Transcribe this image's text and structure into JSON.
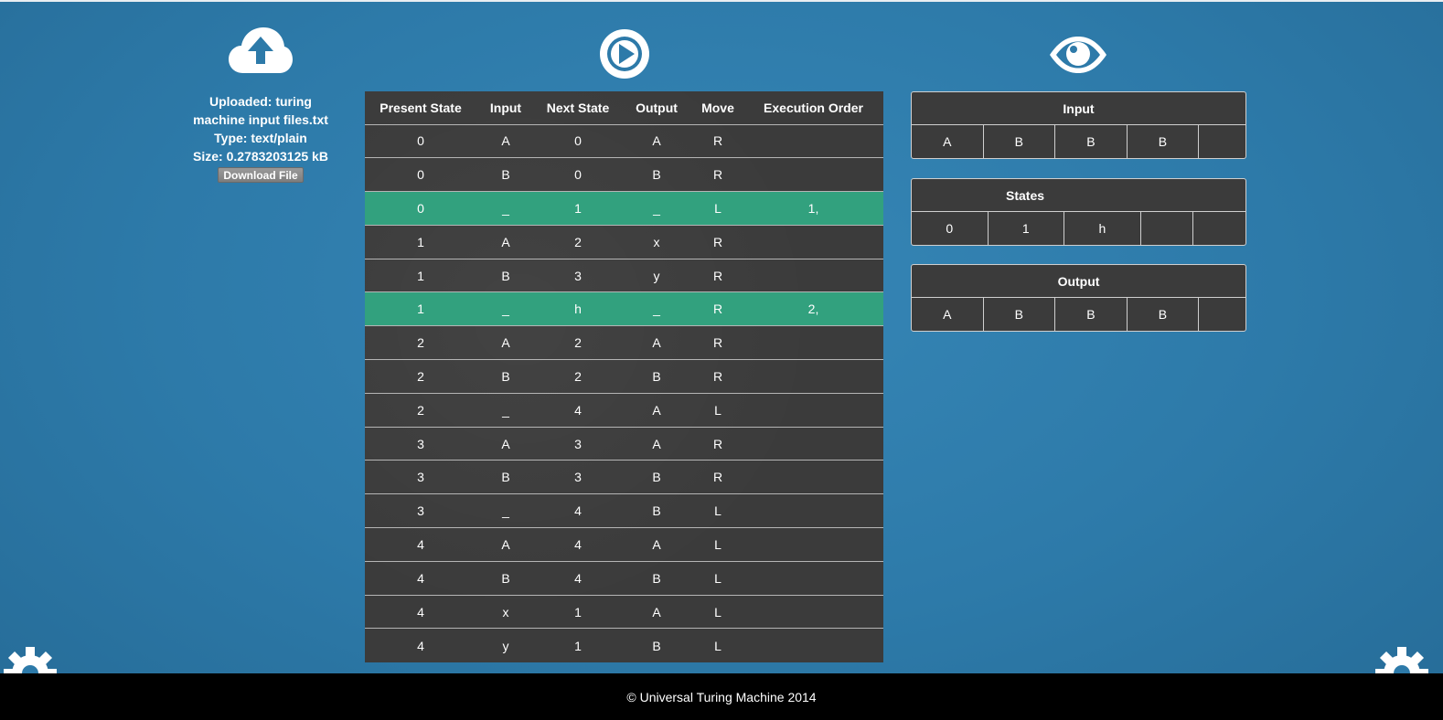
{
  "upload": {
    "icon": "cloud-upload-icon",
    "line1": "Uploaded: turing",
    "line2": "machine input files.txt",
    "type": "Type: text/plain",
    "size": "Size: 0.2783203125 kB",
    "download_label": "Download File"
  },
  "icons": {
    "play": "play-icon",
    "eye": "eye-icon",
    "gear": "gear-icon"
  },
  "rules": {
    "headers": [
      "Present State",
      "Input",
      "Next State",
      "Output",
      "Move",
      "Execution Order"
    ],
    "rows": [
      [
        "0",
        "A",
        "0",
        "A",
        "R",
        ""
      ],
      [
        "0",
        "B",
        "0",
        "B",
        "R",
        ""
      ],
      [
        "0",
        "_",
        "1",
        "_",
        "L",
        "1,"
      ],
      [
        "1",
        "A",
        "2",
        "x",
        "R",
        ""
      ],
      [
        "1",
        "B",
        "3",
        "y",
        "R",
        ""
      ],
      [
        "1",
        "_",
        "h",
        "_",
        "R",
        "2,"
      ],
      [
        "2",
        "A",
        "2",
        "A",
        "R",
        ""
      ],
      [
        "2",
        "B",
        "2",
        "B",
        "R",
        ""
      ],
      [
        "2",
        "_",
        "4",
        "A",
        "L",
        ""
      ],
      [
        "3",
        "A",
        "3",
        "A",
        "R",
        ""
      ],
      [
        "3",
        "B",
        "3",
        "B",
        "R",
        ""
      ],
      [
        "3",
        "_",
        "4",
        "B",
        "L",
        ""
      ],
      [
        "4",
        "A",
        "4",
        "A",
        "L",
        ""
      ],
      [
        "4",
        "B",
        "4",
        "B",
        "L",
        ""
      ],
      [
        "4",
        "x",
        "1",
        "A",
        "L",
        ""
      ],
      [
        "4",
        "y",
        "1",
        "B",
        "L",
        ""
      ]
    ]
  },
  "input_panel": {
    "title": "Input",
    "cells": [
      "A",
      "B",
      "B",
      "B",
      ""
    ]
  },
  "states_panel": {
    "title": "States",
    "cells": [
      "0",
      "1",
      "h",
      "",
      ""
    ]
  },
  "output_panel": {
    "title": "Output",
    "cells": [
      "A",
      "B",
      "B",
      "B",
      ""
    ]
  },
  "footer": {
    "text": "© Universal Turing Machine 2014"
  },
  "colors": {
    "background": "#2d7aa9",
    "active_row": "#32a17e",
    "table_bg": "#3b3b3b"
  }
}
